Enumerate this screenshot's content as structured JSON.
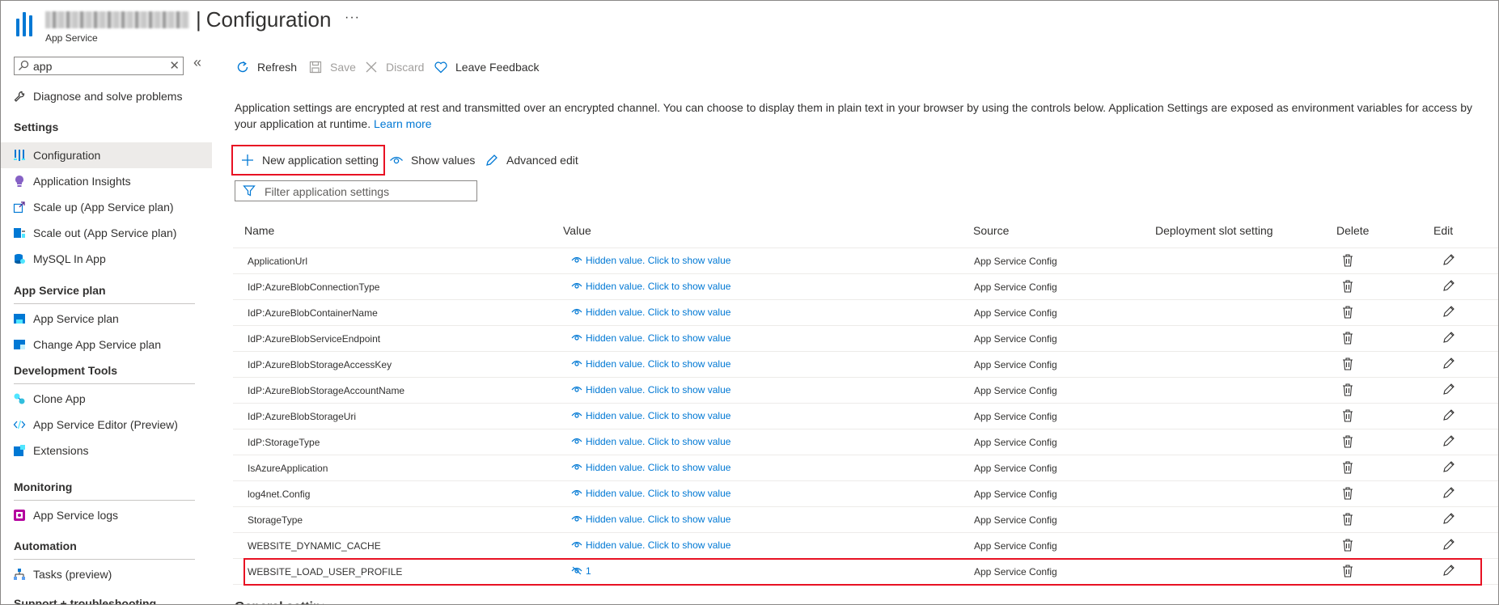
{
  "header": {
    "title": "Configuration",
    "subtitle": "App Service",
    "more": "···"
  },
  "sidebar": {
    "search_value": "app",
    "clear": "✕",
    "collapse": "«",
    "top_items": [
      {
        "label": "Diagnose and solve problems",
        "icon": "wrench-icon"
      }
    ],
    "sections": [
      {
        "title": "Settings",
        "items": [
          {
            "label": "Configuration",
            "icon": "configuration-icon",
            "active": true
          },
          {
            "label": "Application Insights",
            "icon": "lightbulb-icon"
          },
          {
            "label": "Scale up (App Service plan)",
            "icon": "scale-up-icon"
          },
          {
            "label": "Scale out (App Service plan)",
            "icon": "scale-out-icon"
          },
          {
            "label": "MySQL In App",
            "icon": "mysql-icon"
          }
        ]
      },
      {
        "title": "App Service plan",
        "items": [
          {
            "label": "App Service plan",
            "icon": "app-service-plan-icon"
          },
          {
            "label": "Change App Service plan",
            "icon": "change-plan-icon"
          }
        ]
      },
      {
        "title": "Development Tools",
        "items": [
          {
            "label": "Clone App",
            "icon": "clone-icon"
          },
          {
            "label": "App Service Editor (Preview)",
            "icon": "code-icon"
          },
          {
            "label": "Extensions",
            "icon": "extensions-icon"
          }
        ]
      },
      {
        "title": "Monitoring",
        "items": [
          {
            "label": "App Service logs",
            "icon": "logs-icon"
          }
        ]
      },
      {
        "title": "Automation",
        "items": [
          {
            "label": "Tasks (preview)",
            "icon": "tasks-icon"
          }
        ]
      }
    ],
    "cut_section": "Support + troubleshooting"
  },
  "toolbar": {
    "refresh": "Refresh",
    "save": "Save",
    "discard": "Discard",
    "feedback": "Leave Feedback"
  },
  "main": {
    "top_cut": "Application settings",
    "description": "Application settings are encrypted at rest and transmitted over an encrypted channel. You can choose to display them in plain text in your browser by using the controls below. Application Settings are exposed as environment variables for access by your application at runtime.",
    "learn_more": "Learn more",
    "new_setting": "New application setting",
    "show_values": "Show values",
    "advanced_edit": "Advanced edit",
    "filter_placeholder": "Filter application settings",
    "columns": {
      "name": "Name",
      "value": "Value",
      "source": "Source",
      "slot": "Deployment slot setting",
      "delete": "Delete",
      "edit": "Edit"
    },
    "rows": [
      {
        "name": "ApplicationUrl",
        "value": "Hidden value. Click to show value",
        "source": "App Service Config"
      },
      {
        "name": "IdP:AzureBlobConnectionType",
        "value": "Hidden value. Click to show value",
        "source": "App Service Config"
      },
      {
        "name": "IdP:AzureBlobContainerName",
        "value": "Hidden value. Click to show value",
        "source": "App Service Config"
      },
      {
        "name": "IdP:AzureBlobServiceEndpoint",
        "value": "Hidden value. Click to show value",
        "source": "App Service Config"
      },
      {
        "name": "IdP:AzureBlobStorageAccessKey",
        "value": "Hidden value. Click to show value",
        "source": "App Service Config"
      },
      {
        "name": "IdP:AzureBlobStorageAccountName",
        "value": "Hidden value. Click to show value",
        "source": "App Service Config"
      },
      {
        "name": "IdP:AzureBlobStorageUri",
        "value": "Hidden value. Click to show value",
        "source": "App Service Config"
      },
      {
        "name": "IdP:StorageType",
        "value": "Hidden value. Click to show value",
        "source": "App Service Config"
      },
      {
        "name": "IsAzureApplication",
        "value": "Hidden value. Click to show value",
        "source": "App Service Config"
      },
      {
        "name": "log4net.Config",
        "value": "Hidden value. Click to show value",
        "source": "App Service Config"
      },
      {
        "name": "StorageType",
        "value": "Hidden value. Click to show value",
        "source": "App Service Config"
      },
      {
        "name": "WEBSITE_DYNAMIC_CACHE",
        "value": "Hidden value. Click to show value",
        "source": "App Service Config"
      },
      {
        "name": "WEBSITE_LOAD_USER_PROFILE",
        "value": "1",
        "source": "App Service Config",
        "revealed": true
      }
    ],
    "bottom_cut": "General settings"
  },
  "colors": {
    "accent": "#0078d4",
    "highlight": "#e81123",
    "active_bg": "#edebe9"
  }
}
